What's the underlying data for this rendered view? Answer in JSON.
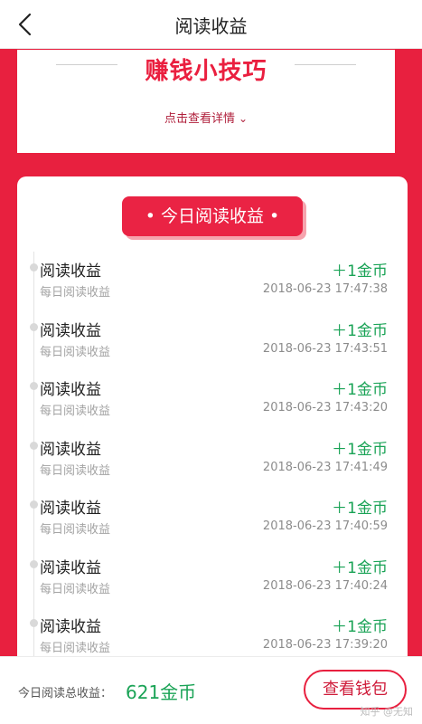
{
  "header": {
    "title": "阅读收益"
  },
  "tips": {
    "title": "赚钱小技巧",
    "link_label": "点击查看详情"
  },
  "section": {
    "title": "• 今日阅读收益 •"
  },
  "records": [
    {
      "title": "阅读收益",
      "subtitle": "每日阅读收益",
      "amount": "＋1金币",
      "time": "2018-06-23 17:47:38"
    },
    {
      "title": "阅读收益",
      "subtitle": "每日阅读收益",
      "amount": "＋1金币",
      "time": "2018-06-23 17:43:51"
    },
    {
      "title": "阅读收益",
      "subtitle": "每日阅读收益",
      "amount": "＋1金币",
      "time": "2018-06-23 17:43:20"
    },
    {
      "title": "阅读收益",
      "subtitle": "每日阅读收益",
      "amount": "＋1金币",
      "time": "2018-06-23 17:41:49"
    },
    {
      "title": "阅读收益",
      "subtitle": "每日阅读收益",
      "amount": "＋1金币",
      "time": "2018-06-23 17:40:59"
    },
    {
      "title": "阅读收益",
      "subtitle": "每日阅读收益",
      "amount": "＋1金币",
      "time": "2018-06-23 17:40:24"
    },
    {
      "title": "阅读收益",
      "subtitle": "每日阅读收益",
      "amount": "＋1金币",
      "time": "2018-06-23 17:39:20"
    }
  ],
  "footer": {
    "total_label": "今日阅读总收益：",
    "total_value": "621金币",
    "wallet_button": "查看钱包",
    "watermark": "知乎 @无知"
  },
  "colors": {
    "brand_red": "#e8203f",
    "income_green": "#1aa356"
  },
  "icons": {
    "back": "back-chevron-icon",
    "expand": "chevron-down-icon"
  }
}
